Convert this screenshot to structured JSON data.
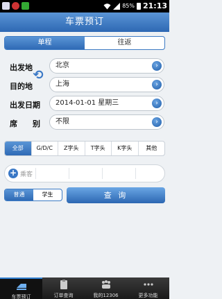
{
  "status_bar": {
    "battery": "85%",
    "time": "21:13",
    "icons": [
      "image-icon",
      "notification-icon",
      "app-icon",
      "wifi-icon",
      "signal-icon",
      "battery-icon"
    ]
  },
  "header": {
    "title": "车票预订"
  },
  "trip_type": {
    "one_way": "单程",
    "round_trip": "往返",
    "selected": "单程"
  },
  "form": {
    "from_label": "出发地",
    "from_value": "北京",
    "to_label": "目的地",
    "to_value": "上海",
    "date_label": "出发日期",
    "date_value": "2014-01-01 星期三",
    "seat_label": "席　　别",
    "seat_value": "不限"
  },
  "train_filters": [
    "全部",
    "G/D/C",
    "Z字头",
    "T字头",
    "K字头",
    "其他"
  ],
  "train_filter_selected": "全部",
  "passenger": {
    "add_label": "乘客"
  },
  "ticket_type": {
    "normal": "普通",
    "student": "学生",
    "selected": "普通"
  },
  "query_button": "查 询",
  "bottom_nav": [
    {
      "label": "车票预订",
      "icon": "train-icon",
      "active": true
    },
    {
      "label": "订单查询",
      "icon": "clipboard-icon",
      "active": false
    },
    {
      "label": "我的12306",
      "icon": "people-icon",
      "active": false
    },
    {
      "label": "更多功能",
      "icon": "more-icon",
      "active": false
    }
  ],
  "colors": {
    "accent": "#2f6ab5",
    "header_top": "#5a95d6",
    "background": "#eef1f4"
  }
}
